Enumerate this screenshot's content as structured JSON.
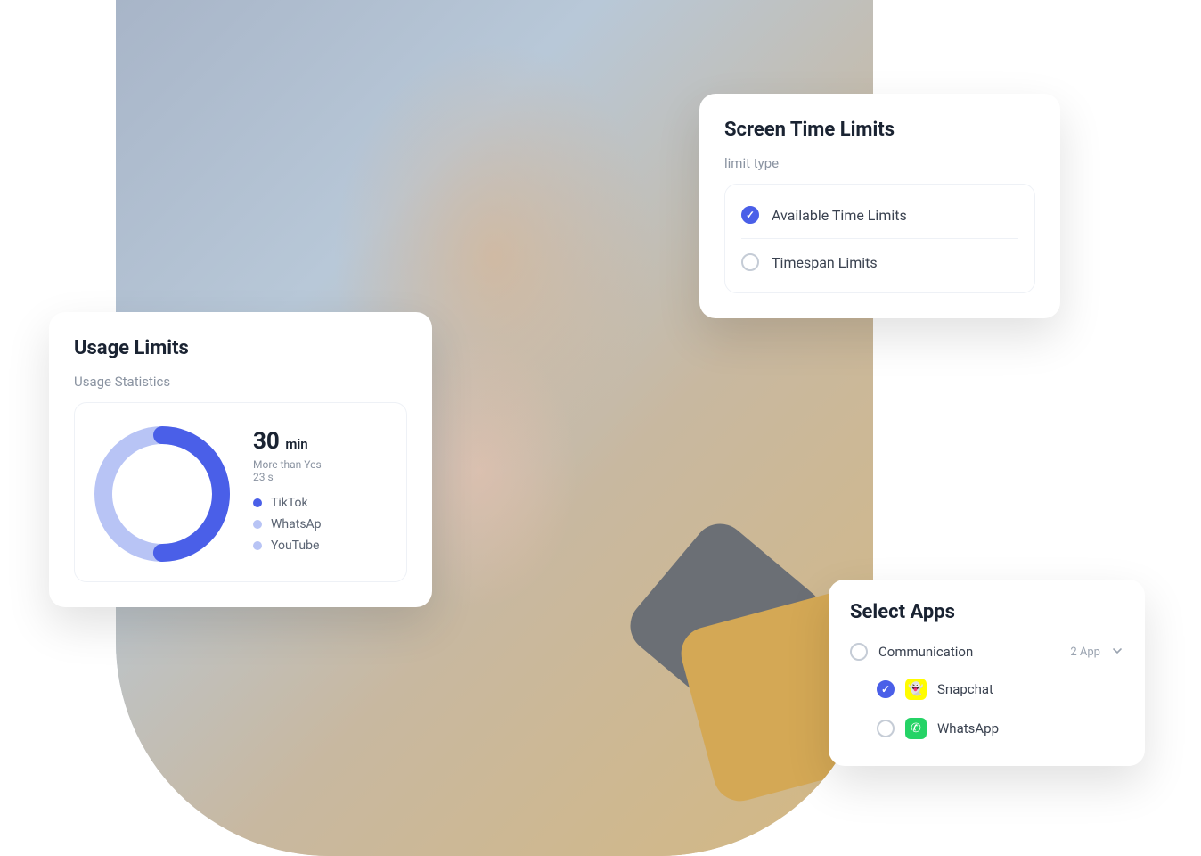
{
  "usage": {
    "title": "Usage Limits",
    "stats_label": "Usage Statistics",
    "time_value": "30",
    "time_unit": "min",
    "sub_text_1": "More than Yes",
    "sub_text_2": "23 s",
    "donut_percent": 50,
    "donut_color_fg": "#4a5fe8",
    "donut_color_bg": "#b8c4f5",
    "legend": [
      {
        "label": "TikTok",
        "color": "#4a5fe8"
      },
      {
        "label": "WhatsAp",
        "color": "#b8c4f5"
      },
      {
        "label": "YouTube",
        "color": "#b8c4f5"
      }
    ]
  },
  "screen_time": {
    "title": "Screen Time Limits",
    "sub": "limit type",
    "options": [
      {
        "label": "Available Time Limits",
        "checked": true
      },
      {
        "label": "Timespan Limits",
        "checked": false
      }
    ]
  },
  "select_apps": {
    "title": "Select Apps",
    "category": {
      "name": "Communication",
      "count": "2 App",
      "checked": false
    },
    "apps": [
      {
        "name": "Snapchat",
        "icon": "snapchat",
        "checked": true
      },
      {
        "name": "WhatsApp",
        "icon": "whatsapp",
        "checked": false
      }
    ]
  },
  "chart_data": {
    "type": "pie",
    "title": "Usage Statistics",
    "series": [
      {
        "name": "TikTok",
        "value": 50,
        "color": "#4a5fe8"
      },
      {
        "name": "WhatsApp",
        "value": 25,
        "color": "#b8c4f5"
      },
      {
        "name": "YouTube",
        "value": 25,
        "color": "#b8c4f5"
      }
    ],
    "total_label": "30 min"
  }
}
